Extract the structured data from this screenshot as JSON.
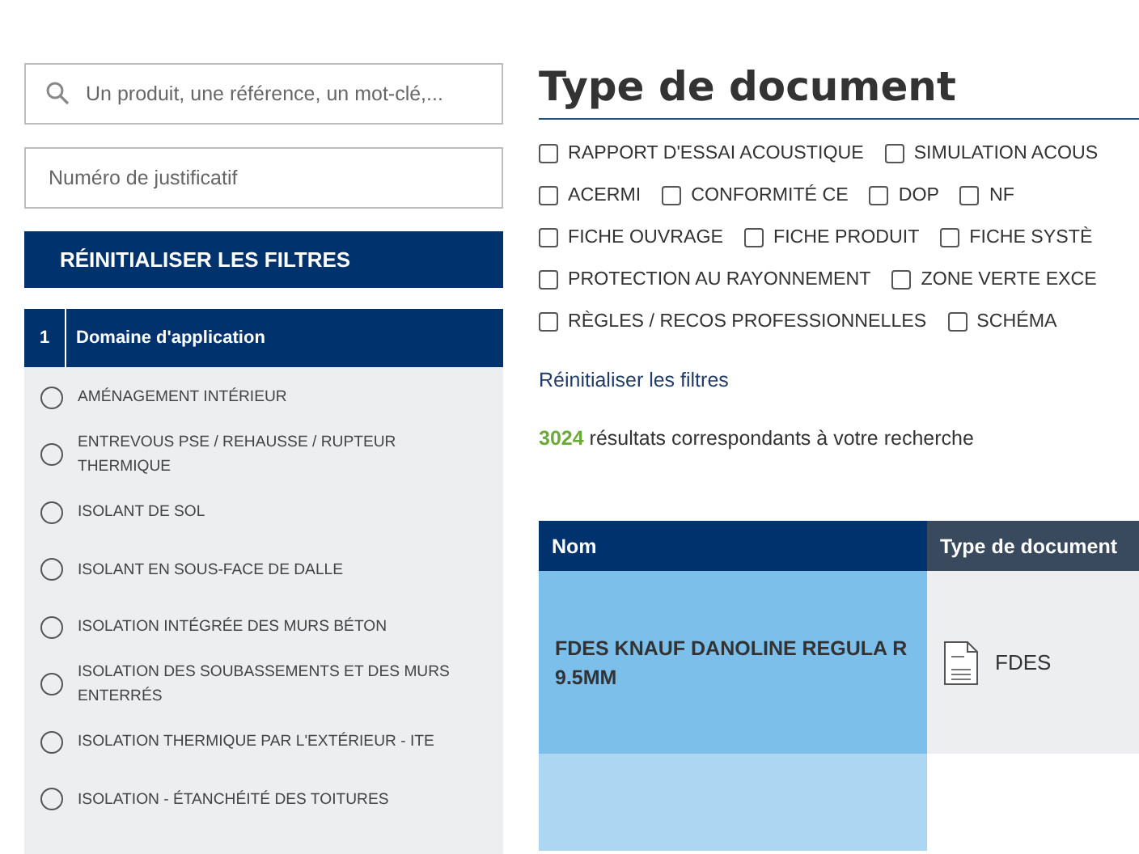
{
  "search": {
    "placeholder": "Un produit, une référence, un mot-clé,..."
  },
  "justificatif": {
    "placeholder": "Numéro de justificatif"
  },
  "reset_button": "RÉINITIALISER LES FILTRES",
  "filter_section": {
    "number": "1",
    "title": "Domaine d'application",
    "options": [
      {
        "label": "AMÉNAGEMENT INTÉRIEUR",
        "selected": false
      },
      {
        "label": "ENTREVOUS PSE / REHAUSSE / RUPTEUR THERMIQUE",
        "selected": false
      },
      {
        "label": "ISOLANT DE SOL",
        "selected": false
      },
      {
        "label": "ISOLANT EN SOUS-FACE DE DALLE",
        "selected": false
      },
      {
        "label": "ISOLATION INTÉGRÉE DES MURS BÉTON",
        "selected": false
      },
      {
        "label": "ISOLATION DES SOUBASSEMENTS ET DES MURS ENTERRÉS",
        "selected": false
      },
      {
        "label": "ISOLATION THERMIQUE PAR L'EXTÉRIEUR - ITE",
        "selected": false
      },
      {
        "label": "ISOLATION - ÉTANCHÉITÉ DES TOITURES",
        "selected": false
      }
    ]
  },
  "heading": "Type de document",
  "doc_types": [
    [
      {
        "label": "RAPPORT D'ESSAI ACOUSTIQUE",
        "checked": false
      },
      {
        "label": "SIMULATION ACOUS",
        "checked": false
      }
    ],
    [
      {
        "label": "ACERMI",
        "checked": false
      },
      {
        "label": "CONFORMITÉ CE",
        "checked": false
      },
      {
        "label": "DOP",
        "checked": false
      },
      {
        "label": "NF",
        "checked": false
      }
    ],
    [
      {
        "label": "FICHE OUVRAGE",
        "checked": false
      },
      {
        "label": "FICHE PRODUIT",
        "checked": false
      },
      {
        "label": "FICHE SYSTÈ",
        "checked": false
      }
    ],
    [
      {
        "label": "PROTECTION AU RAYONNEMENT",
        "checked": false
      },
      {
        "label": "ZONE VERTE EXCE",
        "checked": false
      }
    ],
    [
      {
        "label": "RÈGLES / RECOS PROFESSIONNELLES",
        "checked": false
      },
      {
        "label": "SCHÉMA",
        "checked": false
      }
    ]
  ],
  "reset_link": "Réinitialiser les filtres",
  "results": {
    "count": "3024",
    "text": "résultats correspondants à votre recherche"
  },
  "table": {
    "columns": [
      "Nom",
      "Type de document"
    ],
    "rows": [
      {
        "name": "FDES KNAUF DANOLINE REGULA R 9.5MM",
        "type": "FDES"
      },
      {
        "name": "",
        "type": ""
      }
    ]
  }
}
